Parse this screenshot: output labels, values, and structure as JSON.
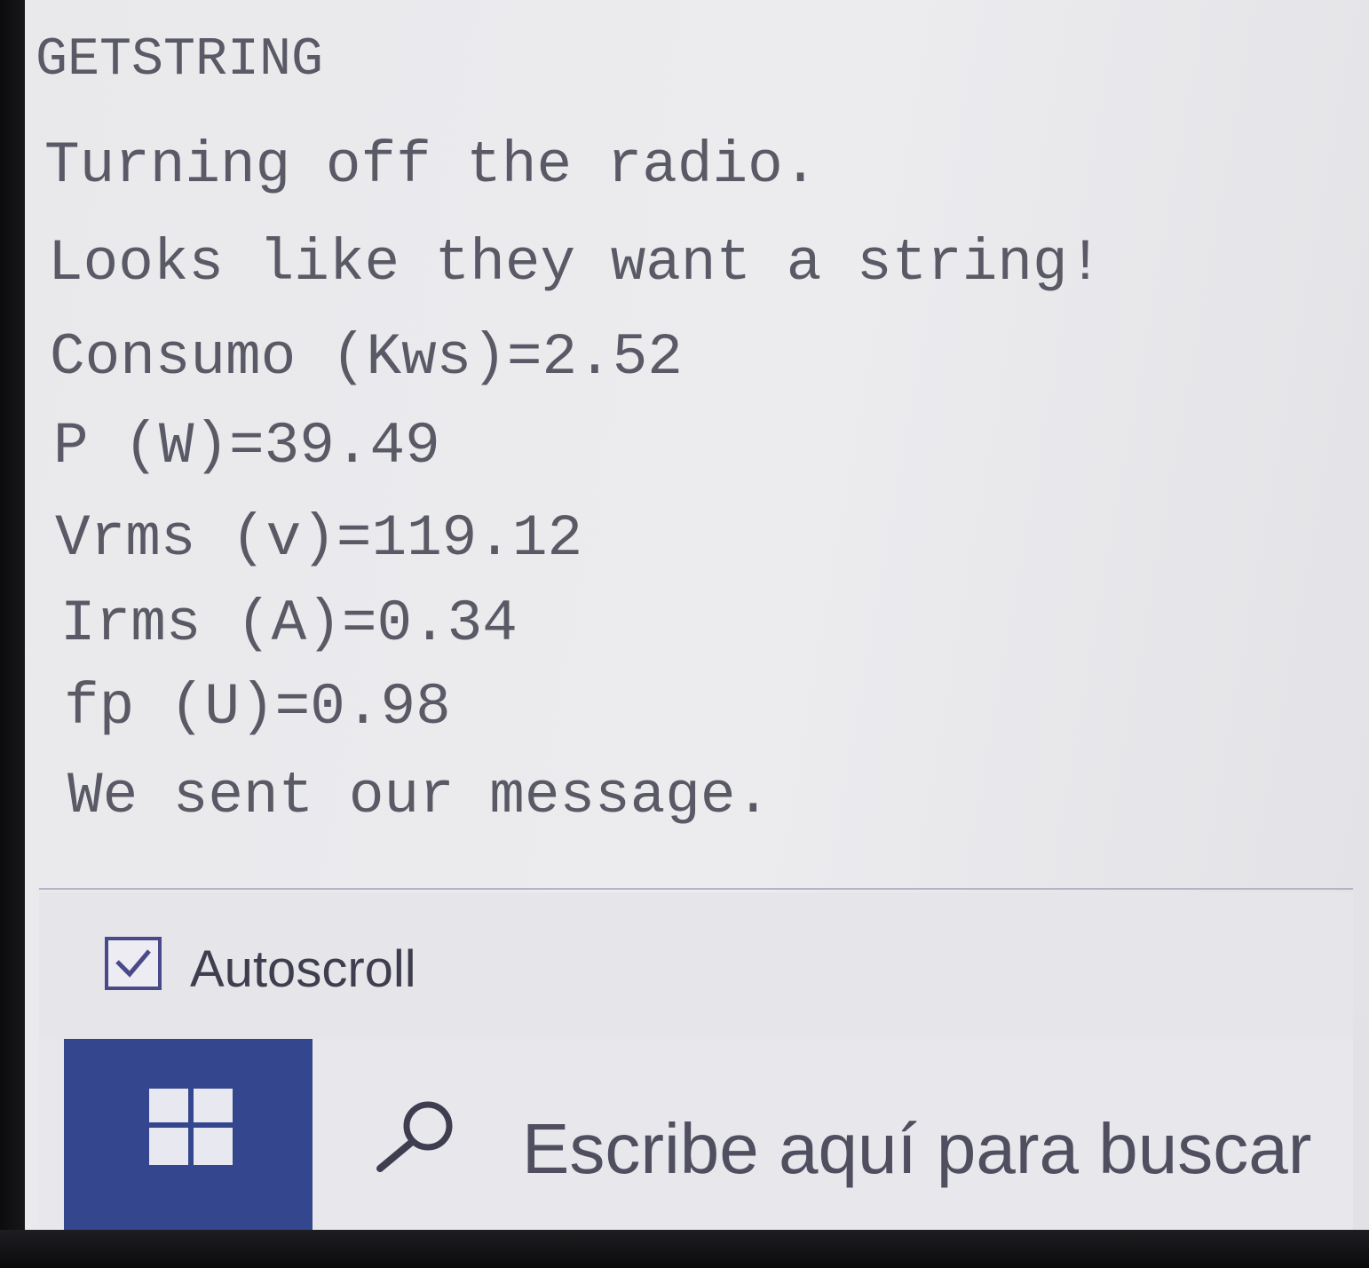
{
  "serial_monitor": {
    "lines": [
      "GETSTRING",
      "Turning off the radio.",
      "Looks like they want a string!",
      "Consumo (Kws)=2.52",
      "P (W)=39.49",
      "Vrms (v)=119.12",
      "Irms (A)=0.34",
      "fp (U)=0.98",
      "We sent our message."
    ]
  },
  "controls": {
    "autoscroll_label": "Autoscroll",
    "autoscroll_checked": true
  },
  "taskbar": {
    "start_icon": "windows-logo-icon",
    "search_icon": "search-icon",
    "search_placeholder": "Escribe aquí para buscar"
  },
  "colors": {
    "start_button": "#34478e",
    "text": "#5a5a66",
    "checkbox_border": "#4a4a8a"
  }
}
